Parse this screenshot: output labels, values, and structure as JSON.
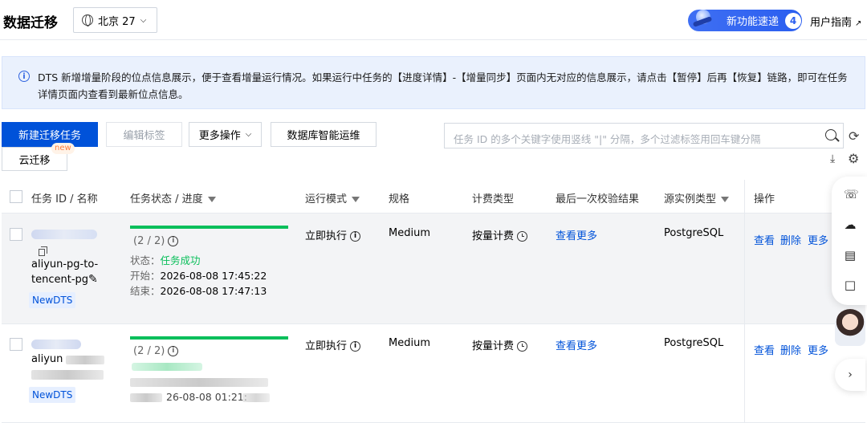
{
  "header": {
    "title": "数据迁移",
    "region": "北京 27",
    "feature_pill": "新功能速递",
    "feature_count": "4",
    "user_guide": "用户指南"
  },
  "notice": {
    "text": "DTS 新增增量阶段的位点信息展示，便于查看增量运行情况。如果运行中任务的【进度详情】-【增量同步】页面内无对应的信息展示，请点击【暂停】后再【恢复】链路，即可在任务详情页面内查看到最新位点信息。"
  },
  "toolbar": {
    "create": "新建迁移任务",
    "edit_tags": "编辑标签",
    "more_ops": "更多操作",
    "db_ops": "数据库智能运维",
    "cloud_migration": "云迁移",
    "new_badge": "new",
    "search_placeholder": "任务 ID 的多个关键字使用竖线 \"|\" 分隔，多个过滤标签用回车键分隔"
  },
  "table": {
    "columns": [
      "任务 ID / 名称",
      "任务状态 / 进度",
      "运行模式",
      "规格",
      "计费类型",
      "最后一次校验结果",
      "源实例类型",
      "操作"
    ],
    "rows": [
      {
        "name_line1": "aliyun-pg-to-",
        "name_line2": "tencent-pg",
        "tag": "NewDTS",
        "progress_text": "(2 / 2)",
        "progress": 1.0,
        "status_label": "状态：",
        "status_value": "任务成功",
        "start_label": "开始：",
        "start_time": "2026-08-08 17:45:22",
        "end_label": "结束：",
        "end_time": "2026-08-08 17:47:13",
        "mode": "立即执行",
        "spec": "Medium",
        "billing": "按量计费",
        "check_result": "查看更多",
        "source_type": "PostgreSQL",
        "op_view": "查看",
        "op_delete": "删除",
        "op_more": "更多"
      },
      {
        "name_line1": "aliyun",
        "tag": "NewDTS",
        "progress_text": "(2 / 2)",
        "progress": 1.0,
        "end_time_partial": "26-08-08 01:21:",
        "mode": "立即执行",
        "spec": "Medium",
        "billing": "按量计费",
        "check_result": "查看更多",
        "source_type": "PostgreSQL",
        "op_view": "查看",
        "op_delete": "删除",
        "op_more": "更多"
      }
    ]
  },
  "colors": {
    "primary": "#0052d9",
    "success": "#0abf5b",
    "notice_bg": "#eaf1fd"
  },
  "icons": [
    "globe-icon",
    "chevron-down-icon",
    "external-link-icon",
    "info-icon",
    "search-icon",
    "refresh-icon",
    "download-icon",
    "settings-icon",
    "filter-icon",
    "copy-icon",
    "edit-icon",
    "clock-icon",
    "headset-icon",
    "cloud-icon",
    "book-icon",
    "chat-icon",
    "chevron-right-icon"
  ]
}
